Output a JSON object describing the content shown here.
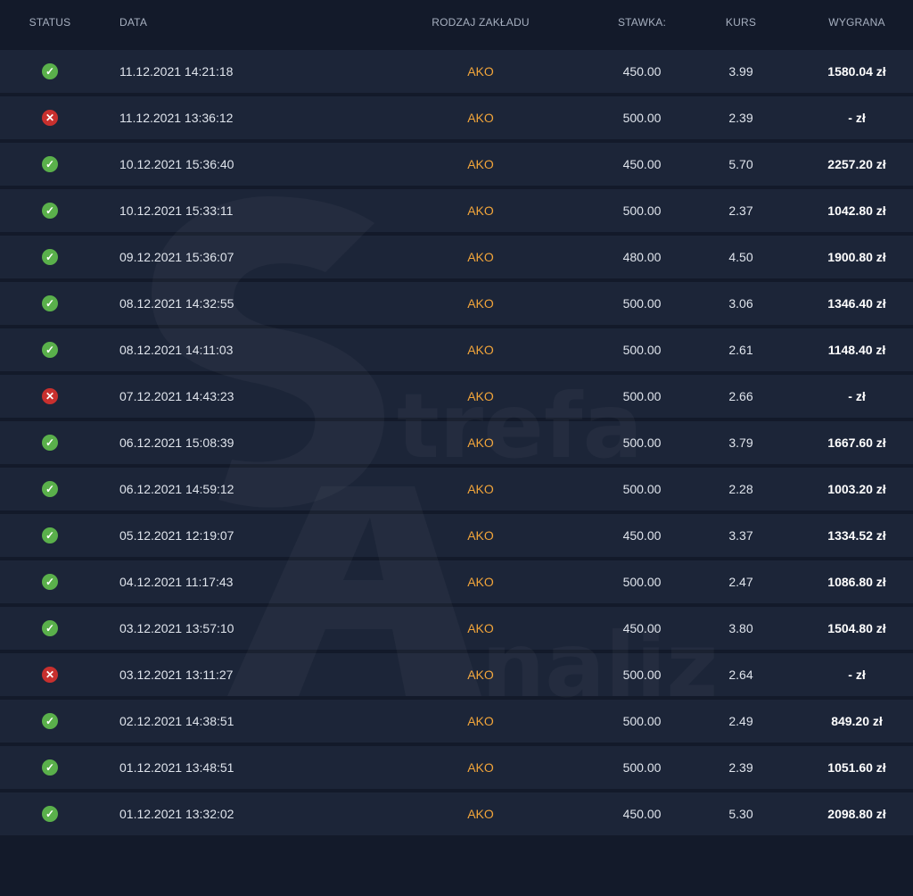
{
  "headers": {
    "status": "STATUS",
    "date": "DATA",
    "type": "RODZAJ ZAKŁADU",
    "stake": "STAWKA:",
    "odds": "KURS",
    "win": "WYGRANA"
  },
  "colors": {
    "background": "#131a2a",
    "row": "#1c2538",
    "accent_orange": "#f2a53a",
    "won_green": "#5ab04b",
    "lost_red": "#c8302e"
  },
  "icons": {
    "won": "check-circle-icon",
    "lost": "x-circle-icon"
  },
  "watermark": {
    "text_1": "trefa",
    "text_2": "naliz"
  },
  "rows": [
    {
      "status": "won",
      "status_glyph": "✓",
      "date": "11.12.2021 14:21:18",
      "type": "AKO",
      "stake": "450.00",
      "odds": "3.99",
      "win": "1580.04 zł"
    },
    {
      "status": "lost",
      "status_glyph": "✕",
      "date": "11.12.2021 13:36:12",
      "type": "AKO",
      "stake": "500.00",
      "odds": "2.39",
      "win": "- zł"
    },
    {
      "status": "won",
      "status_glyph": "✓",
      "date": "10.12.2021 15:36:40",
      "type": "AKO",
      "stake": "450.00",
      "odds": "5.70",
      "win": "2257.20 zł"
    },
    {
      "status": "won",
      "status_glyph": "✓",
      "date": "10.12.2021 15:33:11",
      "type": "AKO",
      "stake": "500.00",
      "odds": "2.37",
      "win": "1042.80 zł"
    },
    {
      "status": "won",
      "status_glyph": "✓",
      "date": "09.12.2021 15:36:07",
      "type": "AKO",
      "stake": "480.00",
      "odds": "4.50",
      "win": "1900.80 zł"
    },
    {
      "status": "won",
      "status_glyph": "✓",
      "date": "08.12.2021 14:32:55",
      "type": "AKO",
      "stake": "500.00",
      "odds": "3.06",
      "win": "1346.40 zł"
    },
    {
      "status": "won",
      "status_glyph": "✓",
      "date": "08.12.2021 14:11:03",
      "type": "AKO",
      "stake": "500.00",
      "odds": "2.61",
      "win": "1148.40 zł"
    },
    {
      "status": "lost",
      "status_glyph": "✕",
      "date": "07.12.2021 14:43:23",
      "type": "AKO",
      "stake": "500.00",
      "odds": "2.66",
      "win": "- zł"
    },
    {
      "status": "won",
      "status_glyph": "✓",
      "date": "06.12.2021 15:08:39",
      "type": "AKO",
      "stake": "500.00",
      "odds": "3.79",
      "win": "1667.60 zł"
    },
    {
      "status": "won",
      "status_glyph": "✓",
      "date": "06.12.2021 14:59:12",
      "type": "AKO",
      "stake": "500.00",
      "odds": "2.28",
      "win": "1003.20 zł"
    },
    {
      "status": "won",
      "status_glyph": "✓",
      "date": "05.12.2021 12:19:07",
      "type": "AKO",
      "stake": "450.00",
      "odds": "3.37",
      "win": "1334.52 zł"
    },
    {
      "status": "won",
      "status_glyph": "✓",
      "date": "04.12.2021 11:17:43",
      "type": "AKO",
      "stake": "500.00",
      "odds": "2.47",
      "win": "1086.80 zł"
    },
    {
      "status": "won",
      "status_glyph": "✓",
      "date": "03.12.2021 13:57:10",
      "type": "AKO",
      "stake": "450.00",
      "odds": "3.80",
      "win": "1504.80 zł"
    },
    {
      "status": "lost",
      "status_glyph": "✕",
      "date": "03.12.2021 13:11:27",
      "type": "AKO",
      "stake": "500.00",
      "odds": "2.64",
      "win": "- zł"
    },
    {
      "status": "won",
      "status_glyph": "✓",
      "date": "02.12.2021 14:38:51",
      "type": "AKO",
      "stake": "500.00",
      "odds": "2.49",
      "win": "849.20 zł"
    },
    {
      "status": "won",
      "status_glyph": "✓",
      "date": "01.12.2021 13:48:51",
      "type": "AKO",
      "stake": "500.00",
      "odds": "2.39",
      "win": "1051.60 zł"
    },
    {
      "status": "won",
      "status_glyph": "✓",
      "date": "01.12.2021 13:32:02",
      "type": "AKO",
      "stake": "450.00",
      "odds": "5.30",
      "win": "2098.80 zł"
    }
  ]
}
